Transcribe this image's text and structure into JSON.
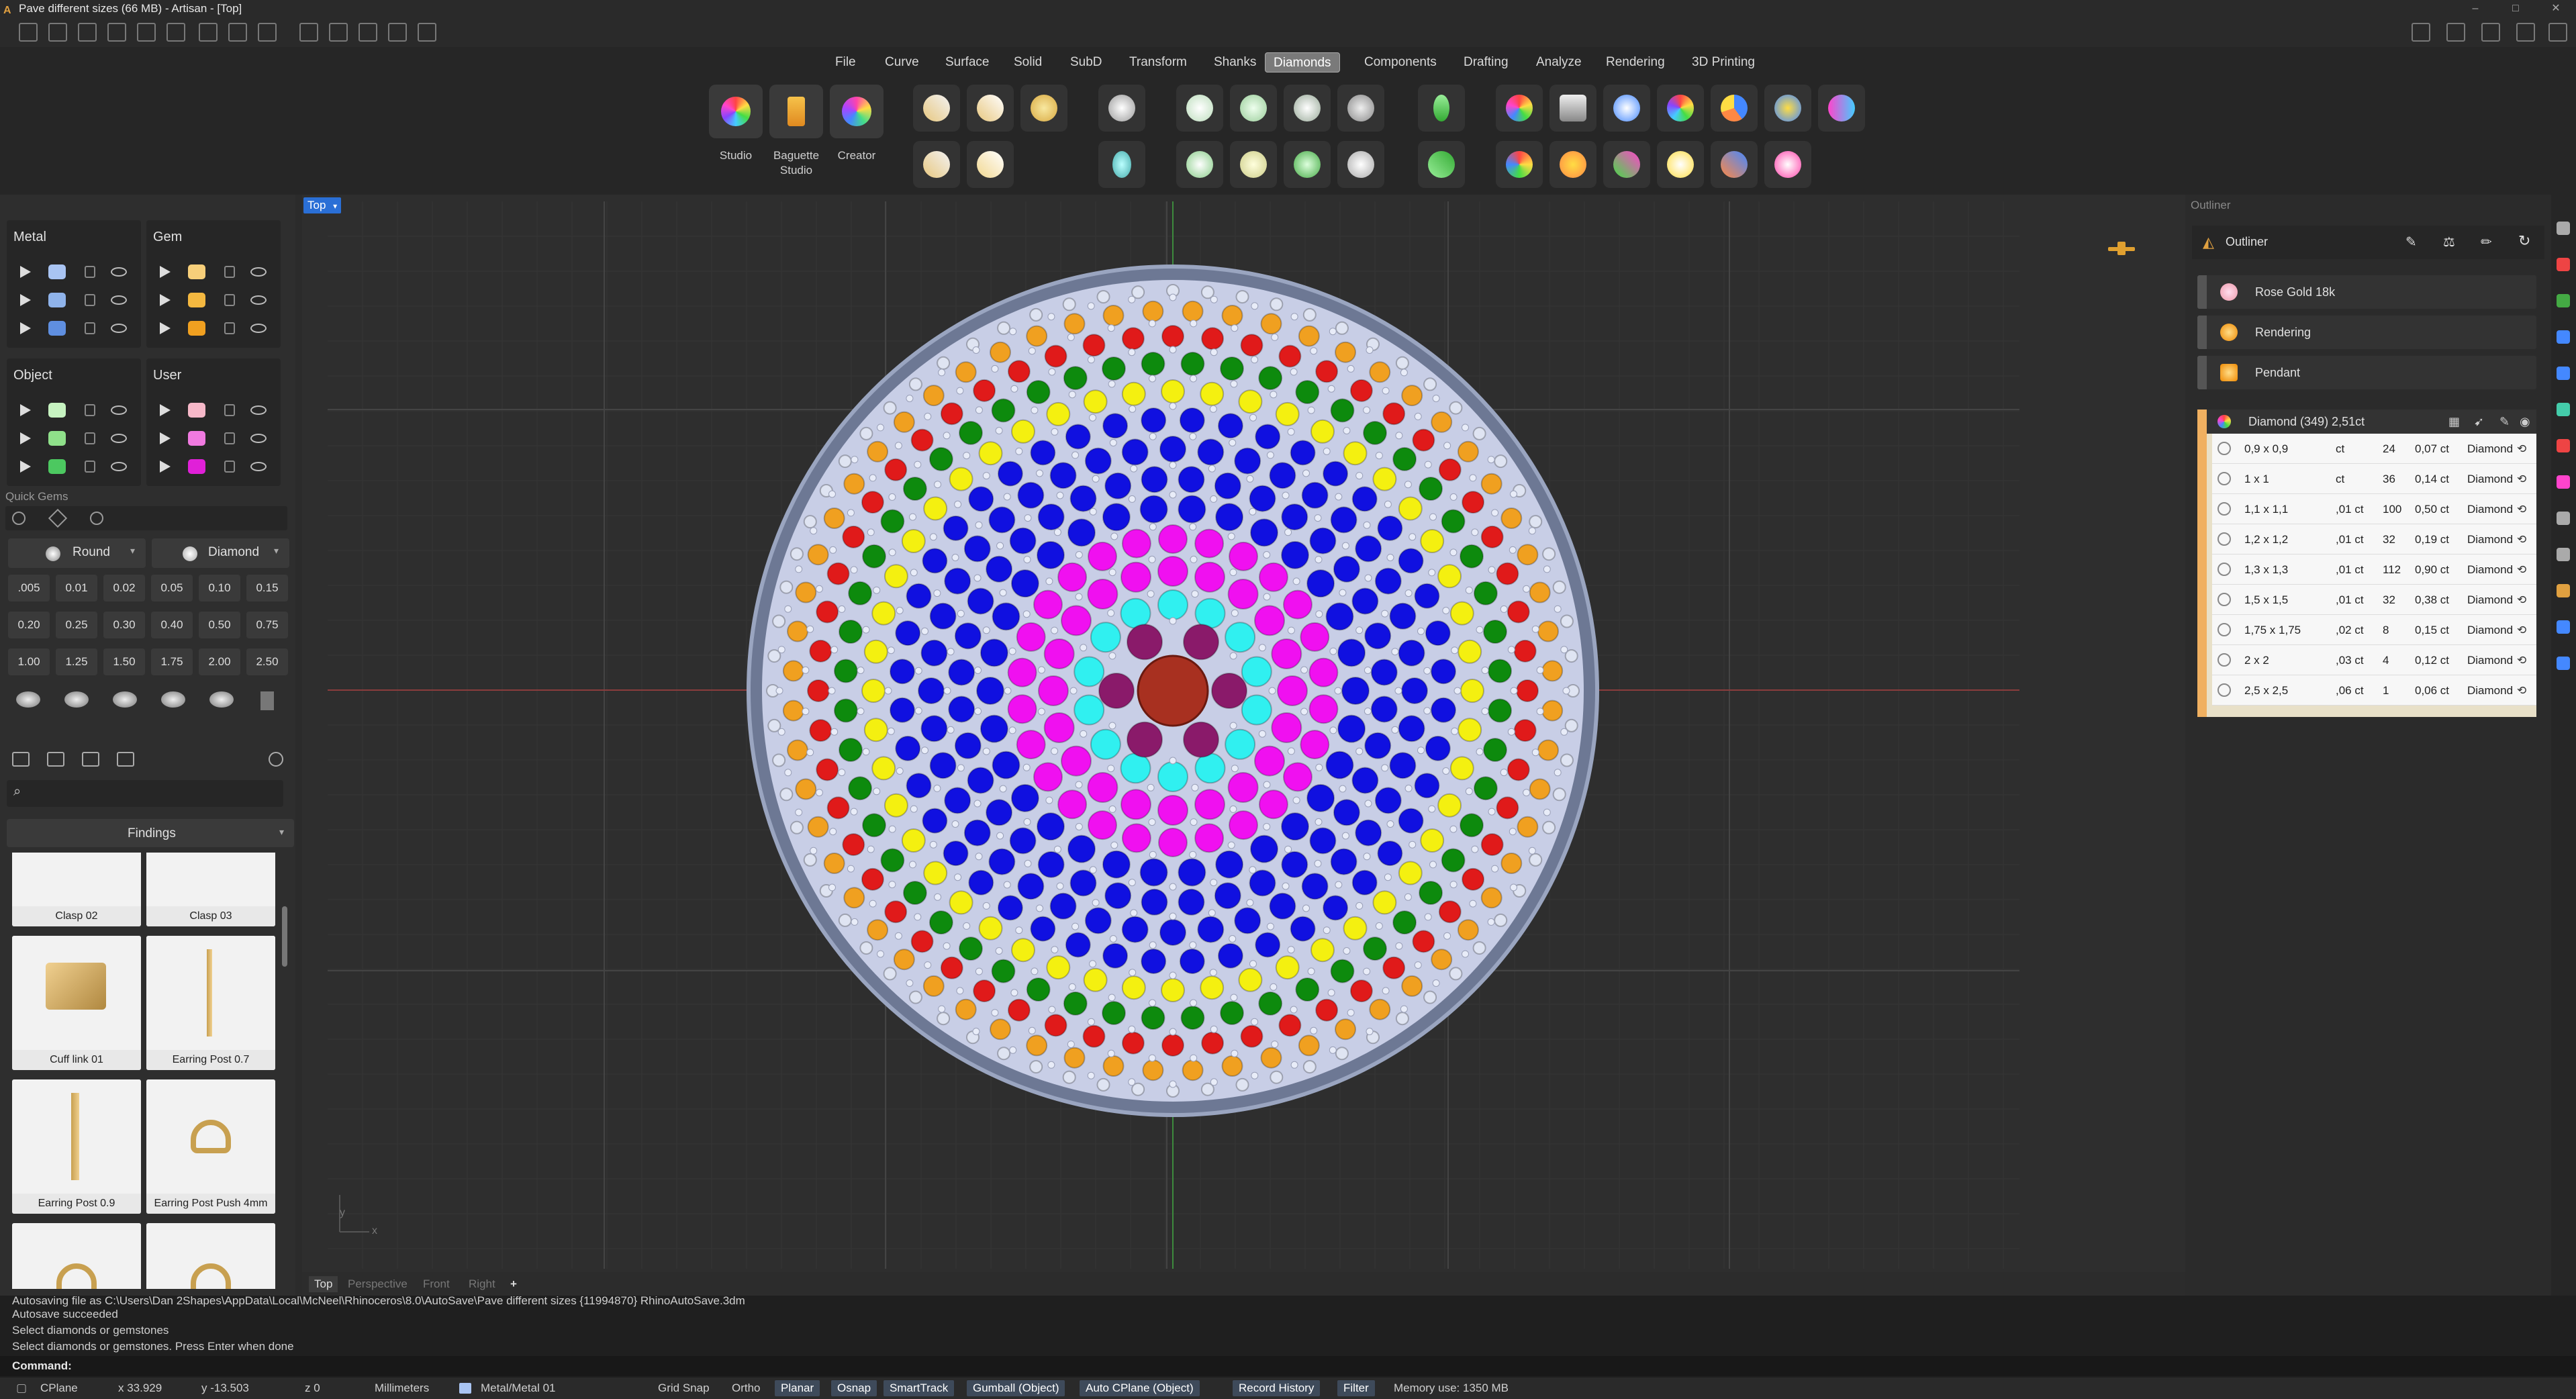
{
  "window": {
    "title": "Pave different sizes (66 MB) - Artisan - [Top]",
    "controls": [
      "–",
      "□",
      "✕"
    ]
  },
  "menu": {
    "items": [
      "File",
      "Curve",
      "Surface",
      "Solid",
      "SubD",
      "Transform",
      "Shanks",
      "Diamonds",
      "Components",
      "Drafting",
      "Analyze",
      "Rendering",
      "3D Printing"
    ],
    "active": "Diamonds"
  },
  "ribbon": {
    "studio_label": "Studio",
    "baguette_label_1": "Baguette",
    "baguette_label_2": "Studio",
    "creator_label": "Creator"
  },
  "layers": {
    "metal_title": "Metal",
    "gem_title": "Gem",
    "object_title": "Object",
    "user_title": "User",
    "metal_colors": [
      "#a9c4f2",
      "#8fb3ea",
      "#5f8fe0"
    ],
    "gem_colors": [
      "#f7cf7a",
      "#f4b840",
      "#f0a020"
    ],
    "object_colors": [
      "#c6f2c0",
      "#8fe08a",
      "#4cc860"
    ],
    "user_colors": [
      "#f6b8c8",
      "#f07ae0",
      "#e020d8"
    ]
  },
  "quickgems": {
    "title": "Quick Gems",
    "shape": "Round",
    "material": "Diamond",
    "sizes": [
      ".005",
      "0.01",
      "0.02",
      "0.05",
      "0.10",
      "0.15",
      "0.20",
      "0.25",
      "0.30",
      "0.40",
      "0.50",
      "0.75",
      "1.00",
      "1.25",
      "1.50",
      "1.75",
      "2.00",
      "2.50"
    ]
  },
  "library": {
    "category": "Findings",
    "items": [
      "Clasp 02",
      "Clasp 03",
      "Cuff link 01",
      "Earring Post 0.7",
      "Earring Post 0.9",
      "Earring Post Push 4mm"
    ]
  },
  "viewport": {
    "label": "Top",
    "tabs": [
      "Top",
      "Perspective",
      "Front",
      "Right",
      "+"
    ],
    "axis_x": "x",
    "axis_y": "y"
  },
  "outliner": {
    "panel_title": "Outliner",
    "title": "Outliner",
    "rows": [
      "Rose Gold 18k",
      "Rendering",
      "Pendant"
    ],
    "gem_header": "Diamond (349) 2,51ct",
    "gems": [
      {
        "size": "0,9 x 0,9",
        "ct": "ct",
        "count": "24",
        "total": "0,07 ct",
        "mat": "Diamond"
      },
      {
        "size": "1 x 1",
        "ct": "ct",
        "count": "36",
        "total": "0,14 ct",
        "mat": "Diamond"
      },
      {
        "size": "1,1 x 1,1",
        "ct": ",01 ct",
        "count": "100",
        "total": "0,50 ct",
        "mat": "Diamond"
      },
      {
        "size": "1,2 x 1,2",
        "ct": ",01 ct",
        "count": "32",
        "total": "0,19 ct",
        "mat": "Diamond"
      },
      {
        "size": "1,3 x 1,3",
        "ct": ",01 ct",
        "count": "112",
        "total": "0,90 ct",
        "mat": "Diamond"
      },
      {
        "size": "1,5 x 1,5",
        "ct": ",01 ct",
        "count": "32",
        "total": "0,38 ct",
        "mat": "Diamond"
      },
      {
        "size": "1,75 x 1,75",
        "ct": ",02 ct",
        "count": "8",
        "total": "0,15 ct",
        "mat": "Diamond"
      },
      {
        "size": "2 x 2",
        "ct": ",03 ct",
        "count": "4",
        "total": "0,12 ct",
        "mat": "Diamond"
      },
      {
        "size": "2,5 x 2,5",
        "ct": ",06 ct",
        "count": "1",
        "total": "0,06 ct",
        "mat": "Diamond"
      }
    ]
  },
  "command": {
    "history": [
      "Autosaving file as C:\\Users\\Dan 2Shapes\\AppData\\Local\\McNeel\\Rhinoceros\\8.0\\AutoSave\\Pave different sizes {11994870} RhinoAutoSave.3dm",
      "Autosave succeeded",
      "Select diamonds or gemstones",
      "Select diamonds or gemstones. Press Enter when done"
    ],
    "prompt": "Command:"
  },
  "status": {
    "cplane": "CPlane",
    "x": "x 33.929",
    "y": "y -13.503",
    "z": "z 0",
    "units": "Millimeters",
    "layer": "Metal/Metal 01",
    "gridsnap": "Grid Snap",
    "ortho": "Ortho",
    "planar": "Planar",
    "osnap": "Osnap",
    "smarttrack": "SmartTrack",
    "gumball": "Gumball (Object)",
    "autocplane": "Auto CPlane (Object)",
    "recordhistory": "Record History",
    "filter": "Filter",
    "memory": "Memory use: 1350 MB"
  }
}
